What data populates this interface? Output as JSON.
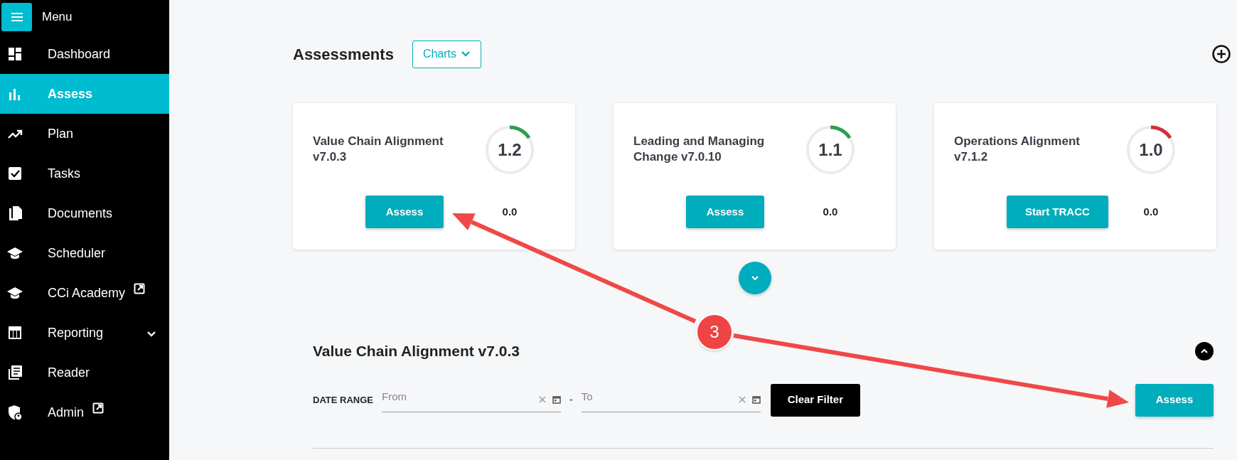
{
  "sidebar": {
    "menu_label": "Menu",
    "items": [
      {
        "label": "Dashboard",
        "selected": false,
        "external": false,
        "expandable": false
      },
      {
        "label": "Assess",
        "selected": true,
        "external": false,
        "expandable": false
      },
      {
        "label": "Plan",
        "selected": false,
        "external": false,
        "expandable": false
      },
      {
        "label": "Tasks",
        "selected": false,
        "external": false,
        "expandable": false
      },
      {
        "label": "Documents",
        "selected": false,
        "external": false,
        "expandable": false
      },
      {
        "label": "Scheduler",
        "selected": false,
        "external": false,
        "expandable": false
      },
      {
        "label": "CCi Academy",
        "selected": false,
        "external": true,
        "expandable": false
      },
      {
        "label": "Reporting",
        "selected": false,
        "external": false,
        "expandable": true
      },
      {
        "label": "Reader",
        "selected": false,
        "external": false,
        "expandable": false
      },
      {
        "label": "Admin",
        "selected": false,
        "external": true,
        "expandable": false
      }
    ]
  },
  "header": {
    "title": "Assessments",
    "charts_button": "Charts"
  },
  "cards": [
    {
      "title": "Value Chain Alignment v7.0.3",
      "score": "1.2",
      "color": "#2e9e4f",
      "button": "Assess",
      "value": "0.0"
    },
    {
      "title": "Leading and Managing Change v7.0.10",
      "score": "1.1",
      "color": "#2e9e4f",
      "button": "Assess",
      "value": "0.0"
    },
    {
      "title": "Operations Alignment v7.1.2",
      "score": "1.0",
      "color": "#d0313b",
      "button": "Start TRACC",
      "value": "0.0"
    }
  ],
  "section": {
    "title": "Value Chain Alignment v7.0.3",
    "date_range_label": "DATE RANGE",
    "from": {
      "placeholder": "From"
    },
    "separator": "-",
    "to": {
      "placeholder": "To"
    },
    "clear_button": "Clear Filter",
    "assess_button": "Assess"
  },
  "annotation": {
    "label": "3"
  }
}
